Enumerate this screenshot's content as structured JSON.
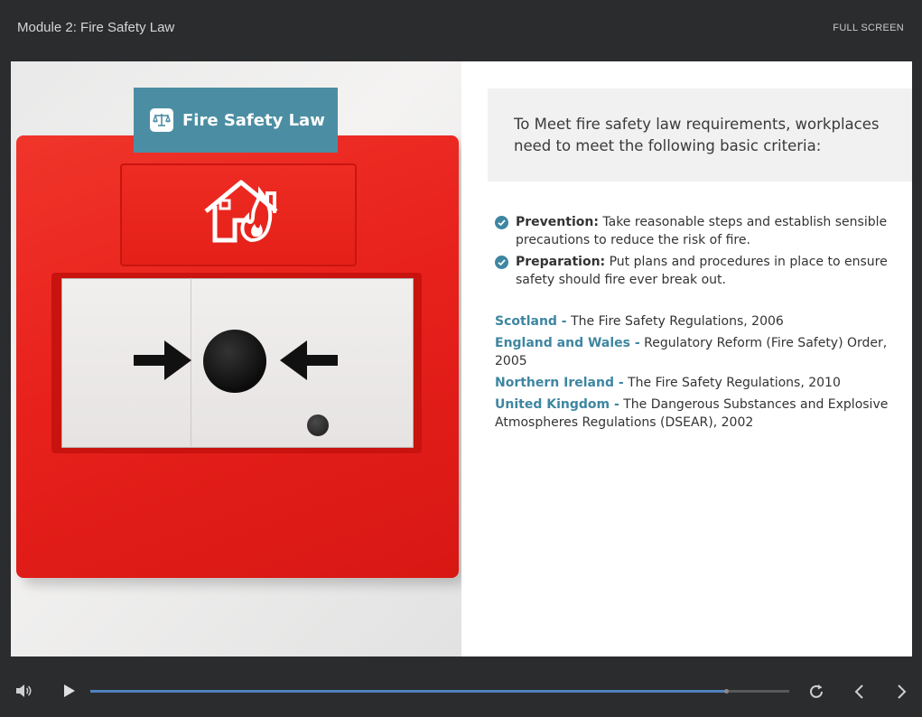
{
  "header": {
    "module_title": "Module 2: Fire Safety Law",
    "fullscreen_label": "FULL SCREEN"
  },
  "banner": {
    "icon": "scales-of-justice-icon",
    "title": "Fire Safety Law"
  },
  "content": {
    "intro": "To Meet fire safety law requirements, workplaces need to meet the following basic criteria:",
    "criteria": [
      {
        "term": "Prevention:",
        "text": " Take reasonable steps and establish sensible precautions to reduce the risk of fire."
      },
      {
        "term": "Preparation:",
        "text": " Put plans and procedures in place to ensure safety should fire ever break out."
      }
    ],
    "laws": [
      {
        "region": "Scotland -",
        "text": " The Fire Safety Regulations, 2006"
      },
      {
        "region": "England and Wales -",
        "text": " Regulatory Reform (Fire Safety) Order, 2005"
      },
      {
        "region": "Northern Ireland -",
        "text": " The Fire Safety Regulations, 2010"
      },
      {
        "region": "United Kingdom -",
        "text": " The Dangerous Substances and Explosive Atmospheres Regulations (DSEAR), 2002"
      }
    ]
  },
  "player": {
    "progress": 0.91,
    "icons": [
      "volume-icon",
      "play-icon",
      "replay-icon",
      "previous-icon",
      "next-icon"
    ]
  },
  "colors": {
    "accent": "#4b8ea3",
    "link": "#3e86a1",
    "progress": "#4f82c0",
    "background": "#2b2c2e"
  }
}
